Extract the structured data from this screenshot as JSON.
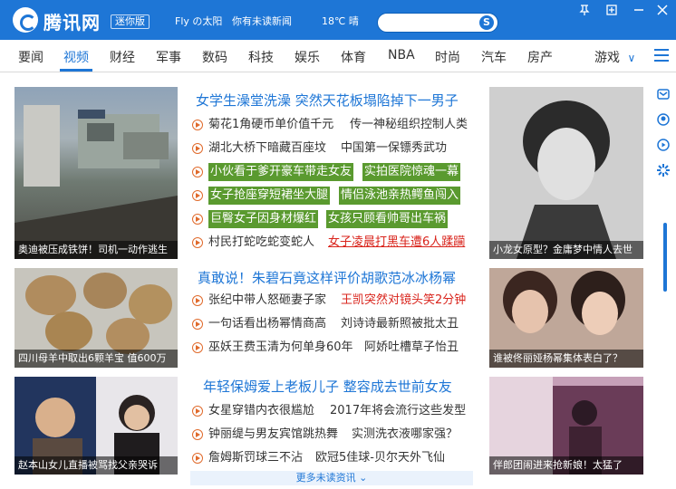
{
  "titlebar": {
    "app_name": "腾讯网",
    "badge": "迷你版",
    "user": "Fly の太阳",
    "unread": "你有未读新闻",
    "weather": "18℃ 晴",
    "search_placeholder": "",
    "search_icon": "S",
    "pin_icon": "pin-icon",
    "restore_icon": "restore-icon",
    "minimize_icon": "minimize-icon",
    "close_icon": "close-icon"
  },
  "nav": {
    "items": [
      "要闻",
      "视频",
      "财经",
      "军事",
      "数码",
      "科技",
      "娱乐",
      "体育",
      "NBA",
      "时尚",
      "汽车",
      "房产"
    ],
    "active": "视频",
    "games": "游戏",
    "games_arrow": "∨"
  },
  "cards": {
    "left": [
      {
        "caption": "奥迪被压成铁饼！司机一动作逃生"
      },
      {
        "caption": "四川母羊中取出6颗羊宝 值600万"
      },
      {
        "caption": "赵本山女儿直播被骂找父亲哭诉"
      }
    ],
    "right": [
      {
        "caption": "小龙女原型？金庸梦中情人去世"
      },
      {
        "caption": "谁被佟丽娅杨幂集体表白了？"
      },
      {
        "caption": "伴郎团闹进来抢新娘！太猛了"
      }
    ]
  },
  "sections": [
    {
      "headline": "女学生澡堂洗澡 突然天花板塌陷掉下一男子",
      "rows": [
        {
          "a": "菊花1角硬币单价值千元",
          "b": "传一神秘组织控制人类"
        },
        {
          "a": "湖北大桥下暗藏百座坟",
          "b": "中国第一保镖秀武功"
        },
        {
          "a": "小伙看于爹开豪车带走女友",
          "b": "实拍医院惊魂一幕"
        },
        {
          "a": "女子抢座穿短裙坐大腿",
          "b": "情侣泳池亲热鳄鱼闯入"
        },
        {
          "a": "巨臀女子因身材爆红",
          "b": "女孩只顾看帅哥出车祸"
        },
        {
          "a": "村民打蛇吃蛇变蛇人",
          "b": "女子凌晨打黑车遭6人蹂躏"
        }
      ]
    },
    {
      "headline": "真敢说！朱碧石竟这样评价胡歌范冰冰杨幂",
      "rows": [
        {
          "a": "张纪中带人怒砸妻子家",
          "b": "王凯突然对镜头笑2分钟"
        },
        {
          "a": "一句话看出杨幂情商高",
          "b": "刘诗诗最新照被批太丑"
        },
        {
          "a": "巫妖王费玉清为何单身60年",
          "b": "阿娇吐槽草子怡丑"
        }
      ]
    },
    {
      "headline": "年轻保姆爱上老板儿子 整容成去世前女友",
      "rows": [
        {
          "a": "女星穿错内衣很尴尬",
          "b": "2017年将会流行这些发型"
        },
        {
          "a": "钟丽缇与男友宾馆跳热舞",
          "b": "实测洗衣液哪家强？"
        },
        {
          "a": "詹姆斯罚球三不沾",
          "b": "欧冠5佳球-贝尔天外飞仙"
        }
      ]
    }
  ],
  "more": "更多未读资讯 ⌄",
  "sidebar": [
    "mail-icon",
    "qq-icon",
    "video-icon",
    "settings-icon"
  ],
  "colors": {
    "accent": "#1e76d6",
    "red": "#d9241c",
    "highlight": "#5a9a2f"
  }
}
